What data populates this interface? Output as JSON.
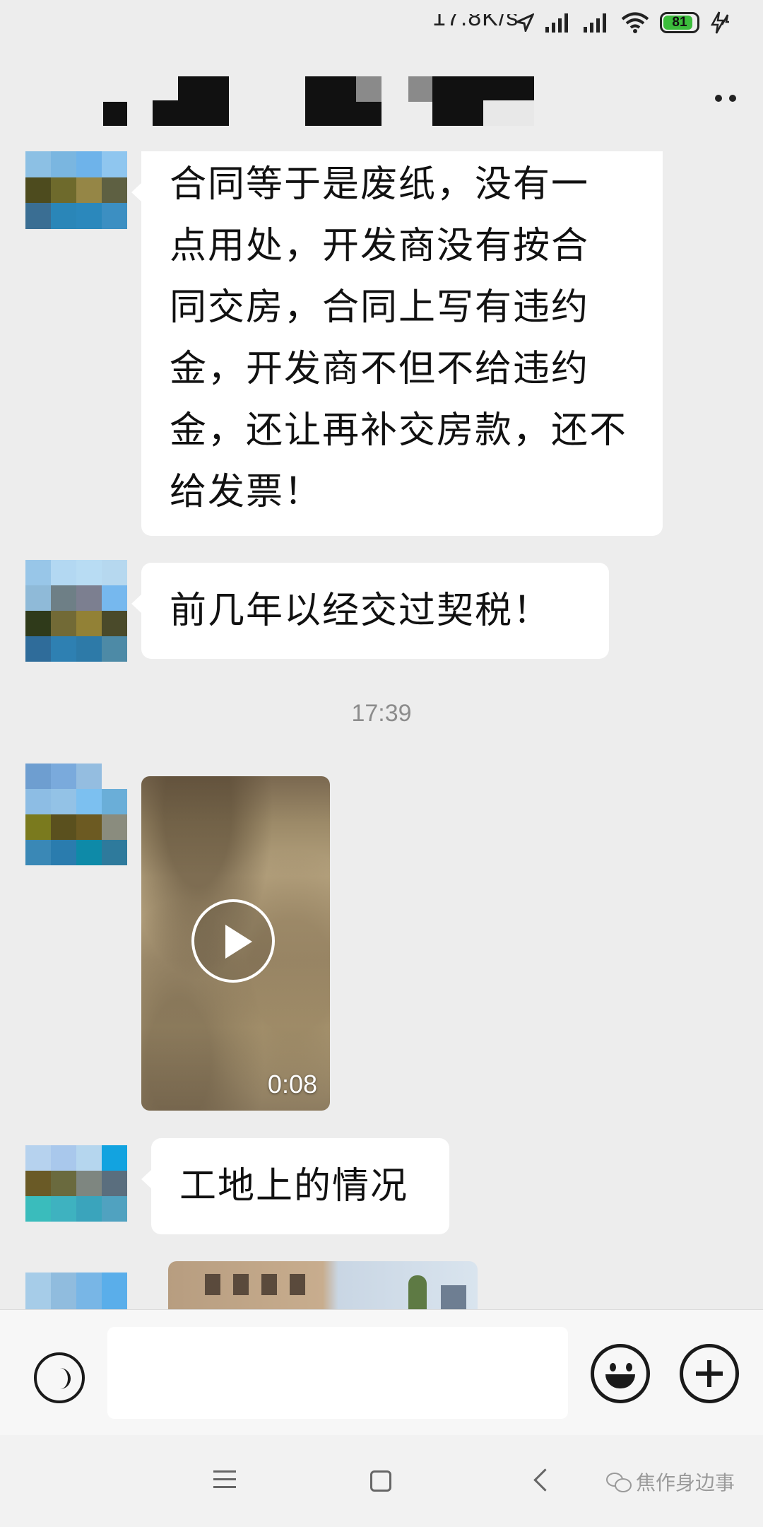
{
  "status_bar": {
    "network_speed": "17.8K/s",
    "battery_level": "81"
  },
  "chat": {
    "messages": [
      {
        "type": "text",
        "text": "合同等于是废纸，没有一\n点用处，开发商没有按合\n同交房，合同上写有违约\n金，开发商不但不给违约\n金，还让再补交房款，还不\n给发票！"
      },
      {
        "type": "text",
        "text": "前几年以经交过契税！"
      },
      {
        "type": "timestamp",
        "text": "17:39"
      },
      {
        "type": "video",
        "duration": "0:08"
      },
      {
        "type": "text",
        "text": "工地上的情况"
      },
      {
        "type": "image"
      }
    ]
  },
  "watermark": {
    "text": "焦作身边事"
  }
}
